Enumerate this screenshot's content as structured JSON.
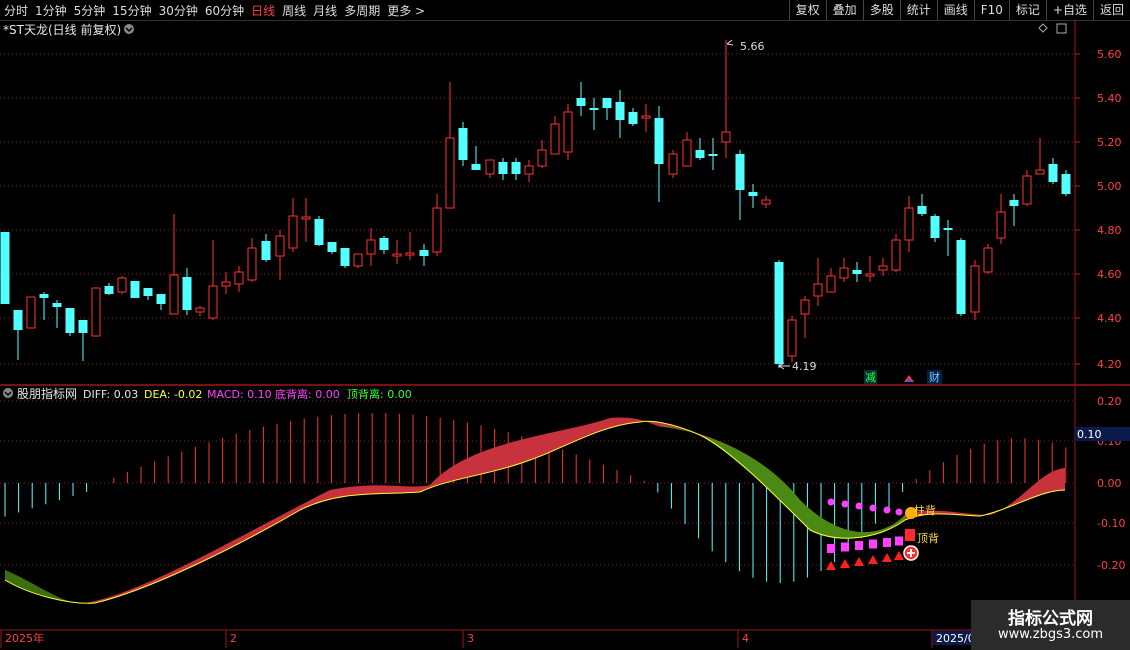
{
  "toolbar": {
    "periods": [
      "分时",
      "1分钟",
      "5分钟",
      "15分钟",
      "30分钟",
      "60分钟",
      "日线",
      "周线",
      "月线",
      "多周期",
      "更多 >"
    ],
    "active_period": "日线",
    "tools": [
      "复权",
      "叠加",
      "多股",
      "统计",
      "画线",
      "F10",
      "标记",
      "+自选",
      "返回"
    ]
  },
  "main_panel": {
    "title": "*ST天龙(日线 前复权)",
    "high_marker": "5.66",
    "low_marker": "4.19",
    "y_ticks": [
      "5.60",
      "5.40",
      "5.20",
      "5.00",
      "4.80",
      "4.60",
      "4.40",
      "4.20"
    ],
    "event_tags": [
      "减",
      "财"
    ],
    "colors": {
      "up": "#ff3232",
      "down": "#54ffff",
      "background": "#000000",
      "grid": "#8a1818"
    }
  },
  "indicator_panel": {
    "name": "股朋指标网",
    "diff_label": "DIFF: 0.03",
    "dea_label": "DEA: -0.02",
    "macd_label": "MACD: 0.10",
    "bottom_div_label": "底背离: 0.00",
    "top_div_label": "顶背离: 0.00",
    "y_ticks": [
      "0.20",
      "0.10",
      "0.00",
      "-0.10",
      "-0.20"
    ],
    "current_value": "0.10",
    "annotations": [
      "柱背",
      "顶背"
    ]
  },
  "date_axis": [
    "2025年",
    "2",
    "3",
    "4",
    "2025/0"
  ],
  "watermark": {
    "line1": "指标公式网",
    "line2": "www.zbgs3.com"
  }
}
